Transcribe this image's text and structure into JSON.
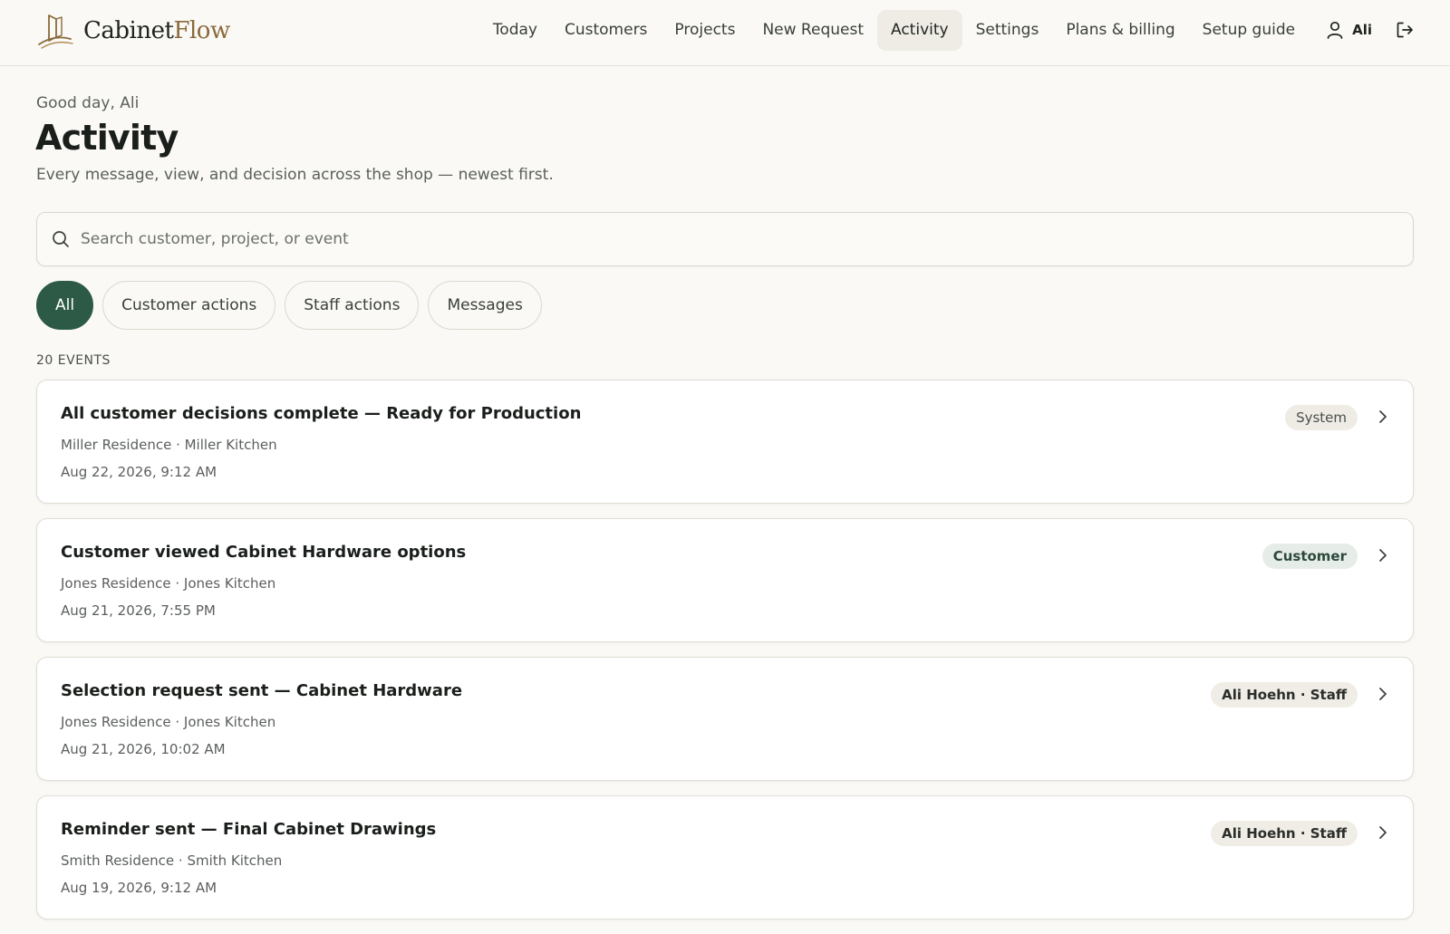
{
  "brand": {
    "name_part1": "Cabinet",
    "name_part2": "Flow"
  },
  "nav": {
    "items": [
      {
        "label": "Today",
        "active": false
      },
      {
        "label": "Customers",
        "active": false
      },
      {
        "label": "Projects",
        "active": false
      },
      {
        "label": "New Request",
        "active": false
      },
      {
        "label": "Activity",
        "active": true
      },
      {
        "label": "Settings",
        "active": false
      },
      {
        "label": "Plans & billing",
        "active": false
      },
      {
        "label": "Setup guide",
        "active": false
      }
    ],
    "user_label": "Ali"
  },
  "page": {
    "greeting": "Good day, Ali",
    "title": "Activity",
    "subtitle": "Every message, view, and decision across the shop — newest first."
  },
  "search": {
    "placeholder": "Search customer, project, or event",
    "value": ""
  },
  "filters": [
    {
      "label": "All",
      "active": true
    },
    {
      "label": "Customer actions",
      "active": false
    },
    {
      "label": "Staff actions",
      "active": false
    },
    {
      "label": "Messages",
      "active": false
    }
  ],
  "event_count": "20 EVENTS",
  "events": [
    {
      "title": "All customer decisions complete — Ready for Production",
      "project": "Miller Residence · Miller Kitchen",
      "time": "Aug 22, 2026, 9:12 AM",
      "badge": "System",
      "badge_type": "system"
    },
    {
      "title": "Customer viewed Cabinet Hardware options",
      "project": "Jones Residence · Jones Kitchen",
      "time": "Aug 21, 2026, 7:55 PM",
      "badge": "Customer",
      "badge_type": "customer"
    },
    {
      "title": "Selection request sent — Cabinet Hardware",
      "project": "Jones Residence · Jones Kitchen",
      "time": "Aug 21, 2026, 10:02 AM",
      "badge": "Ali Hoehn · Staff",
      "badge_type": "staff"
    },
    {
      "title": "Reminder sent — Final Cabinet Drawings",
      "project": "Smith Residence · Smith Kitchen",
      "time": "Aug 19, 2026, 9:12 AM",
      "badge": "Ali Hoehn · Staff",
      "badge_type": "staff"
    }
  ],
  "colors": {
    "accent": "#2c5a47",
    "brand_gold": "#8a6a3c",
    "background": "#faf9f5"
  },
  "icons": {
    "logo": "cabinet-logo-icon",
    "user": "user-icon",
    "logout": "logout-icon",
    "search": "search-icon",
    "chevron": "chevron-right-icon"
  }
}
